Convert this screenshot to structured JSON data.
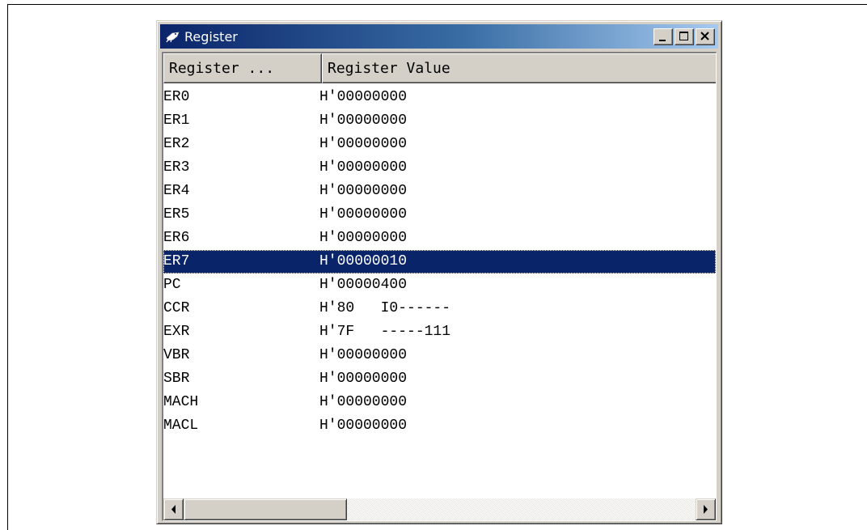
{
  "window": {
    "title": "Register",
    "icon": "register-window-icon",
    "controls": [
      "minimize-icon",
      "maximize-icon",
      "close-icon"
    ]
  },
  "columns": {
    "name": "Register ...",
    "value": "Register Value"
  },
  "registers": [
    {
      "name": "ER0",
      "value": "H'00000000"
    },
    {
      "name": "ER1",
      "value": "H'00000000"
    },
    {
      "name": "ER2",
      "value": "H'00000000"
    },
    {
      "name": "ER3",
      "value": "H'00000000"
    },
    {
      "name": "ER4",
      "value": "H'00000000"
    },
    {
      "name": "ER5",
      "value": "H'00000000"
    },
    {
      "name": "ER6",
      "value": "H'00000000"
    },
    {
      "name": "ER7",
      "value": "H'00000010"
    },
    {
      "name": "PC",
      "value": "H'00000400"
    },
    {
      "name": "CCR",
      "value": "H'80   I0------"
    },
    {
      "name": "EXR",
      "value": "H'7F   -----111"
    },
    {
      "name": "VBR",
      "value": "H'00000000"
    },
    {
      "name": "SBR",
      "value": "H'00000000"
    },
    {
      "name": "MACH",
      "value": "H'00000000"
    },
    {
      "name": "MACL",
      "value": "H'00000000"
    }
  ],
  "selected_register": "ER7",
  "scrollbar": {
    "horizontal_position": 0.0,
    "visible_fraction": 0.37
  },
  "colors": {
    "titlebar_start": "#0a246a",
    "titlebar_end": "#a6caf0",
    "selection": "#0a246a",
    "face": "#d4d0c8"
  }
}
